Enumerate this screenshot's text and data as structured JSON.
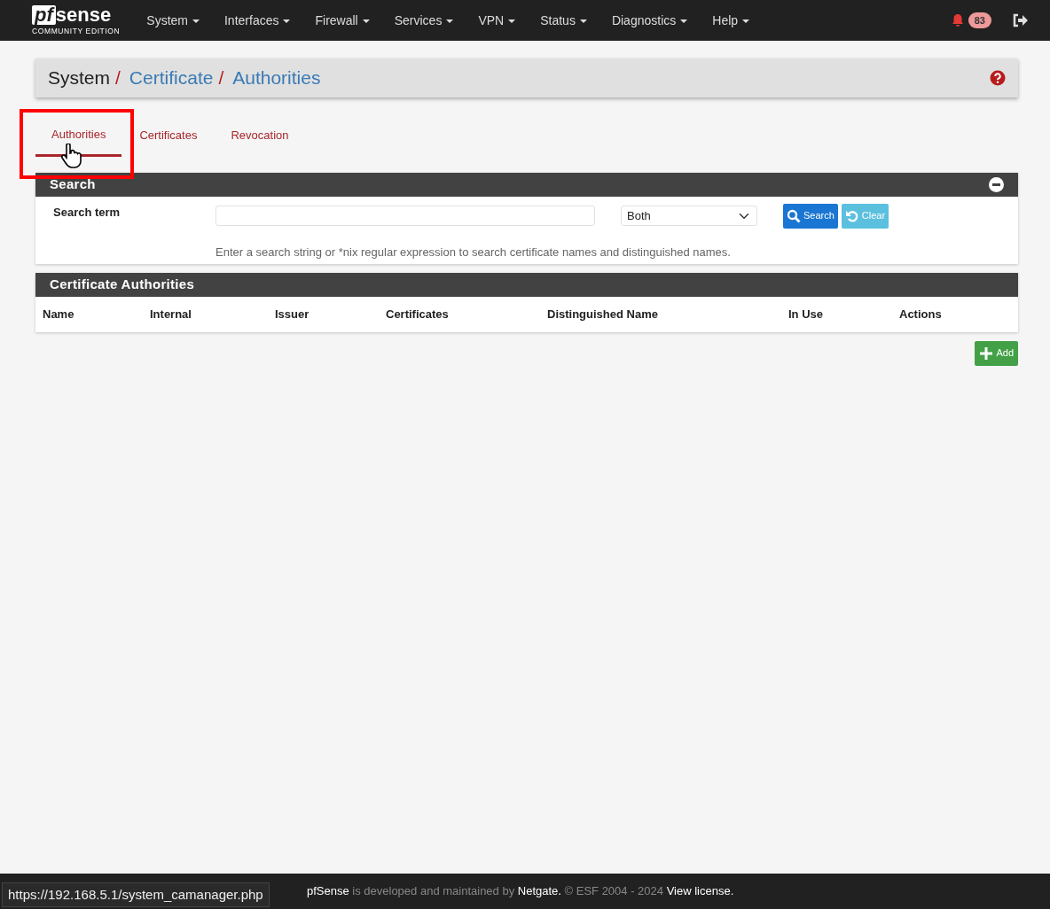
{
  "navbar": {
    "logo": {
      "mark": "pf",
      "name": "sense",
      "edition": "COMMUNITY EDITION"
    },
    "menus": [
      "System",
      "Interfaces",
      "Firewall",
      "Services",
      "VPN",
      "Status",
      "Diagnostics",
      "Help"
    ],
    "notification_count": "83"
  },
  "breadcrumb": [
    "System",
    "Certificate",
    "Authorities"
  ],
  "breadcrumb_separator": "/",
  "tabs": [
    {
      "label": "Authorities",
      "selected": true
    },
    {
      "label": "Certificates",
      "selected": false
    },
    {
      "label": "Revocation",
      "selected": false
    }
  ],
  "search_panel": {
    "title": "Search",
    "label": "Search term",
    "scope": "Both",
    "buttons": [
      {
        "label": "Search",
        "kind": "primary"
      },
      {
        "label": "Clear",
        "kind": "info"
      }
    ],
    "help": "Enter a search string or *nix regular expression to search certificate names and distinguished names."
  },
  "table": {
    "title": "Certificate Authorities",
    "columns": [
      "Name",
      "Internal",
      "Issuer",
      "Certificates",
      "Distinguished Name",
      "In Use",
      "Actions"
    ]
  },
  "add_button": "Add",
  "footer": "**pfSense** is developed and maintained by **Netgate.** © ESF 2004 - 2024 **View license.**",
  "status_url": "https://192.168.5.1/system_camanager.php"
}
